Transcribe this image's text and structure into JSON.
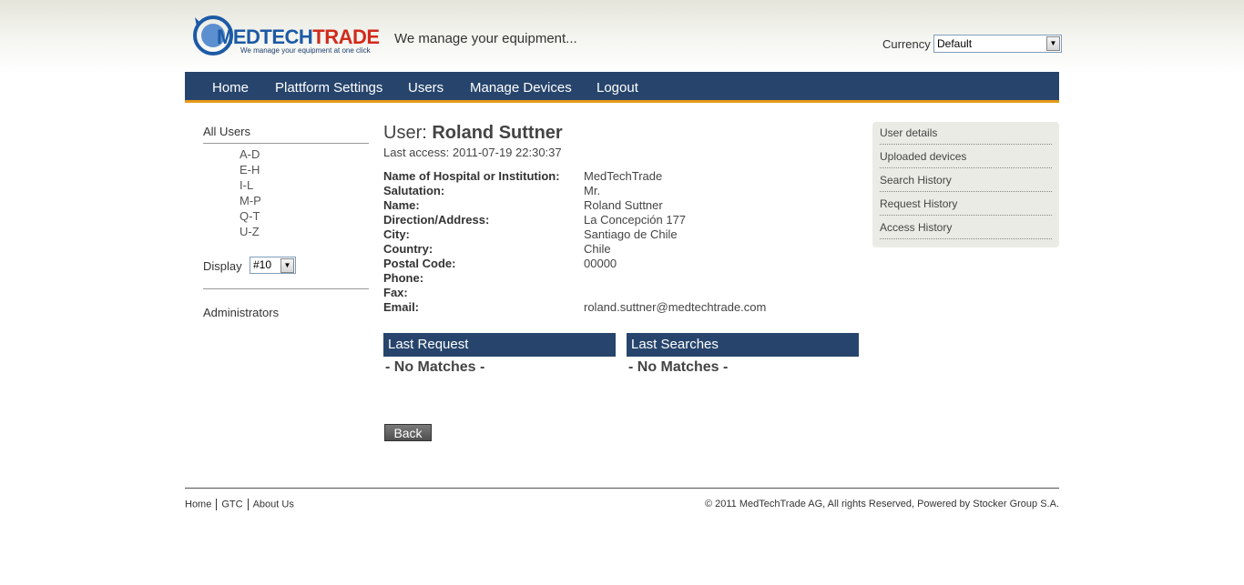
{
  "header": {
    "logo_text_part1": "MEDTECH",
    "logo_text_part2": "TRADE",
    "logo_subtitle": "We manage your equipment at one click",
    "tagline": "We manage your equipment...",
    "currency_label": "Currency",
    "currency_value": "Default"
  },
  "nav": {
    "items": [
      {
        "label": "Home"
      },
      {
        "label": "Plattform Settings"
      },
      {
        "label": "Users"
      },
      {
        "label": "Manage Devices"
      },
      {
        "label": "Logout"
      }
    ]
  },
  "sidebar": {
    "all_users": "All Users",
    "ranges": [
      "A-D",
      "E-H",
      "I-L",
      "M-P",
      "Q-T",
      "U-Z"
    ],
    "display_label": "Display",
    "display_value": "#10",
    "administrators": "Administrators"
  },
  "user": {
    "title_prefix": "User:",
    "name": "Roland Suttner",
    "last_access": "Last access: 2011-07-19 22:30:37",
    "fields": [
      {
        "label": "Name of Hospital or Institution:",
        "value": "MedTechTrade"
      },
      {
        "label": "Salutation:",
        "value": "Mr."
      },
      {
        "label": "Name:",
        "value": "Roland Suttner"
      },
      {
        "label": "Direction/Address:",
        "value": "La Concepción 177"
      },
      {
        "label": "City:",
        "value": "Santiago de Chile"
      },
      {
        "label": "Country:",
        "value": "Chile"
      },
      {
        "label": "Postal Code:",
        "value": "00000"
      },
      {
        "label": "Phone:",
        "value": ""
      },
      {
        "label": "Fax:",
        "value": ""
      },
      {
        "label": "Email:",
        "value": "roland.suttner@medtechtrade.com"
      }
    ]
  },
  "panels": {
    "last_request": {
      "title": "Last Request",
      "empty": "- No Matches -"
    },
    "last_searches": {
      "title": "Last Searches",
      "empty": "- No Matches -"
    }
  },
  "back_label": "Back",
  "right_menu": {
    "items": [
      {
        "label": "User details"
      },
      {
        "label": "Uploaded devices"
      },
      {
        "label": "Search History"
      },
      {
        "label": "Request History"
      },
      {
        "label": "Access History"
      }
    ]
  },
  "footer": {
    "links": [
      "Home",
      "GTC",
      "About Us"
    ],
    "copyright": "© 2011 MedTechTrade AG, All rights Reserved, Powered by Stocker Group S.A."
  },
  "colors": {
    "nav_bg": "#27456c",
    "nav_accent": "#e69a19",
    "logo_blue": "#1c5aa6",
    "logo_red": "#d12a1c"
  }
}
